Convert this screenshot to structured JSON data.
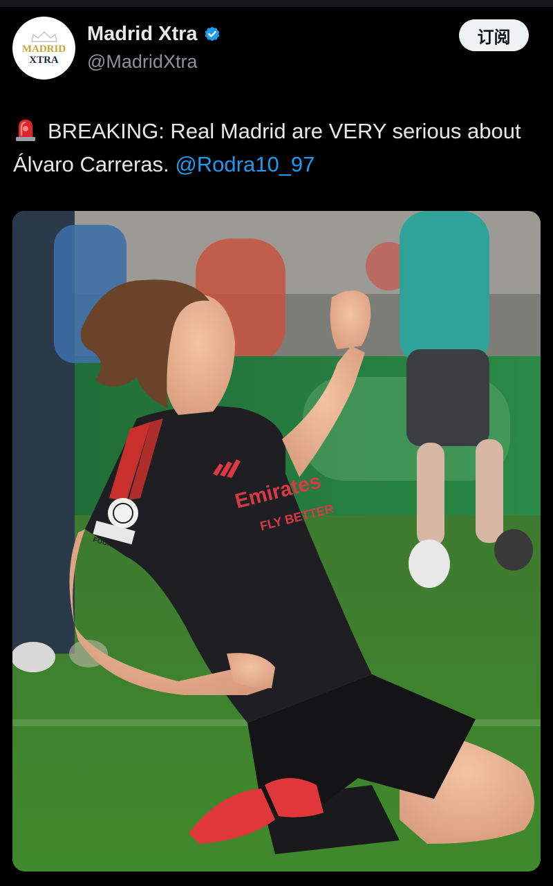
{
  "author": {
    "name": "Madrid Xtra",
    "handle": "@MadridXtra",
    "avatar_text_line1": "MADRID",
    "avatar_text_line2": "XTRA",
    "verified_icon": "verified-badge-icon"
  },
  "subscribe_label": "订阅",
  "tweet": {
    "siren_icon": "rotating-light-icon",
    "text": "BREAKING: Real Madrid are VERY serious about Álvaro Carreras.",
    "mention": "@Rodra10_97"
  },
  "media": {
    "jersey_sponsor_line1": "Emirates",
    "jersey_sponsor_line2": "FLY BETTER",
    "sleeve_badge": "FOUNDATION"
  },
  "colors": {
    "background": "#000000",
    "text": "#e7e9ea",
    "secondary_text": "#8b9299",
    "link": "#1d9bf0",
    "verified": "#1d9bf0",
    "button_bg": "#eff3f4"
  }
}
